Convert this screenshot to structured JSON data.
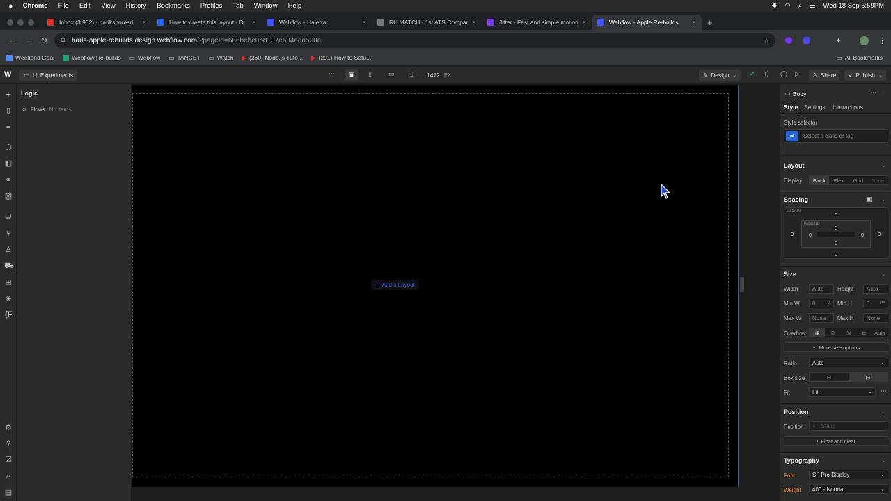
{
  "mac_menu": {
    "apple": "",
    "app": "Chrome",
    "items": [
      "File",
      "Edit",
      "View",
      "History",
      "Bookmarks",
      "Profiles",
      "Tab",
      "Window",
      "Help"
    ],
    "datetime": "Wed 18 Sep  5:59PM"
  },
  "tabs": [
    {
      "title": "Inbox (3,932) - harikshoresri",
      "color": "#d93025"
    },
    {
      "title": "How to create this layout - Di",
      "color": "#2563eb"
    },
    {
      "title": "Webflow - Haletra",
      "color": "#4353ff"
    },
    {
      "title": "RH MATCH - 1st ATS Compan",
      "color": "#777777"
    },
    {
      "title": "Jitter · Fast and simple motion",
      "color": "#7c3aed"
    },
    {
      "title": "Webflow - Apple Re-builds",
      "color": "#4353ff"
    }
  ],
  "address": {
    "url": "haris-apple-rebuilds.design.webflow.com",
    "path": "/?pageId=666bebe0b8137e634ada500e"
  },
  "bookmarks": [
    "Weekend Goal",
    "Webflow Re-builds",
    "Webflow",
    "TANCET",
    "Watch",
    "(260) Node.js Tuto...",
    "(291) How to Setu..."
  ],
  "all_bookmarks": "All Bookmarks",
  "webflow": {
    "project": "UI Experiments",
    "width_value": "1472",
    "width_unit": "PX",
    "mode": "Design",
    "share": "Share",
    "publish": "Publish"
  },
  "logic": {
    "title": "Logic",
    "flows": "Flows",
    "flows_status": "No items"
  },
  "canvas": {
    "add_layout": "Add a Layout"
  },
  "style_panel": {
    "element": "Body",
    "tabs": [
      "Style",
      "Settings",
      "Interactions"
    ],
    "style_selector": "Style selector",
    "selector_placeholder": "Select a class or tag",
    "layout": "Layout",
    "display": "Display",
    "display_options": [
      "Block",
      "Flex",
      "Grid",
      "None"
    ],
    "spacing": "Spacing",
    "margin": "MARGIN",
    "padding": "PADDING",
    "margin_values": {
      "top": "0",
      "right": "0",
      "bottom": "0",
      "left": "0"
    },
    "padding_values": {
      "top": "0",
      "right": "0",
      "bottom": "0",
      "left": "0"
    },
    "size": "Size",
    "width": "Width",
    "height": "Height",
    "auto": "Auto",
    "min_w": "Min W",
    "min_h": "Min H",
    "max_w": "Max W",
    "max_h": "Max H",
    "zero": "0",
    "px": "PX",
    "none": "None",
    "overflow": "Overflow",
    "overflow_auto": "Auto",
    "more_size": "More size options",
    "ratio": "Ratio",
    "ratio_value": "Auto",
    "box_size": "Box size",
    "fit": "Fit",
    "fit_value": "Fill",
    "position": "Position",
    "position_label": "Position",
    "position_value": "Static",
    "float_clear": "Float and clear",
    "typography": "Typography",
    "font": "Font",
    "font_value": "SF Pro Display",
    "weight": "Weight",
    "weight_value": "400 - Normal"
  },
  "colors": {
    "accent": "#4353ff",
    "canvas_bg": "#000000",
    "orange": "#ff8a3d"
  }
}
